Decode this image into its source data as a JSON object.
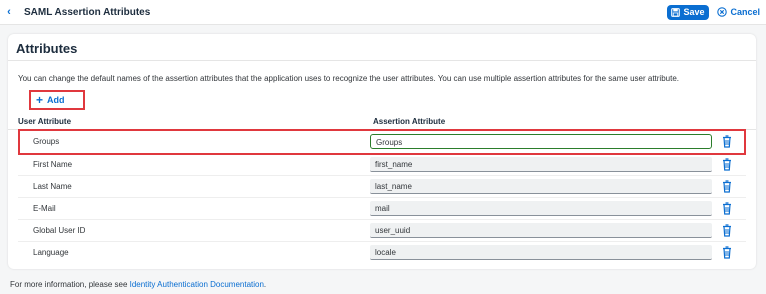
{
  "header": {
    "title": "SAML Assertion Attributes",
    "save_label": "Save",
    "cancel_label": "Cancel"
  },
  "card": {
    "title": "Attributes",
    "description": "You can change the default names of the assertion attributes that the application uses to recognize the user attributes. You can use multiple assertion attributes for the same user attribute.",
    "add_label": "Add",
    "columns": {
      "user": "User Attribute",
      "assertion": "Assertion Attribute"
    },
    "rows": [
      {
        "user": "Groups",
        "assertion": "Groups"
      },
      {
        "user": "First Name",
        "assertion": "first_name"
      },
      {
        "user": "Last Name",
        "assertion": "last_name"
      },
      {
        "user": "E-Mail",
        "assertion": "mail"
      },
      {
        "user": "Global User ID",
        "assertion": "user_uuid"
      },
      {
        "user": "Language",
        "assertion": "locale"
      }
    ]
  },
  "footer": {
    "prefix": "For more information, please see ",
    "link": "Identity Authentication Documentation",
    "suffix": "."
  },
  "colors": {
    "accent": "#0a6ed1",
    "highlight": "#e0383e",
    "focus_border": "#2b7d2b"
  },
  "icons": {
    "back": "chevron-left-icon",
    "save": "save-icon",
    "cancel": "cancel-circle-icon",
    "add": "plus-icon",
    "delete": "trash-icon"
  }
}
